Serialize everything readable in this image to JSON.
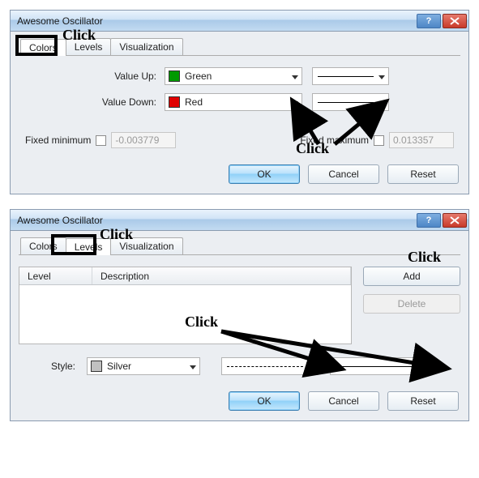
{
  "dialog1": {
    "title": "Awesome Oscillator",
    "tabs": [
      "Colors",
      "Levels",
      "Visualization"
    ],
    "active_tab": 0,
    "value_up_label": "Value Up:",
    "value_up_color_name": "Green",
    "value_up_color_hex": "#009a00",
    "value_down_label": "Value Down:",
    "value_down_color_name": "Red",
    "value_down_color_hex": "#e00000",
    "fixed_min_label": "Fixed minimum",
    "fixed_min_value": "-0.003779",
    "fixed_max_label": "Fixed maximum",
    "fixed_max_value": "0.013357",
    "ok": "OK",
    "cancel": "Cancel",
    "reset": "Reset"
  },
  "dialog2": {
    "title": "Awesome Oscillator",
    "tabs": [
      "Colors",
      "Levels",
      "Visualization"
    ],
    "active_tab": 1,
    "table_headers": {
      "level": "Level",
      "description": "Description"
    },
    "add": "Add",
    "delete": "Delete",
    "style_label": "Style:",
    "style_color_name": "Silver",
    "style_color_hex": "#c0c0c0",
    "ok": "OK",
    "cancel": "Cancel",
    "reset": "Reset"
  },
  "annotations": {
    "click": "Click"
  }
}
